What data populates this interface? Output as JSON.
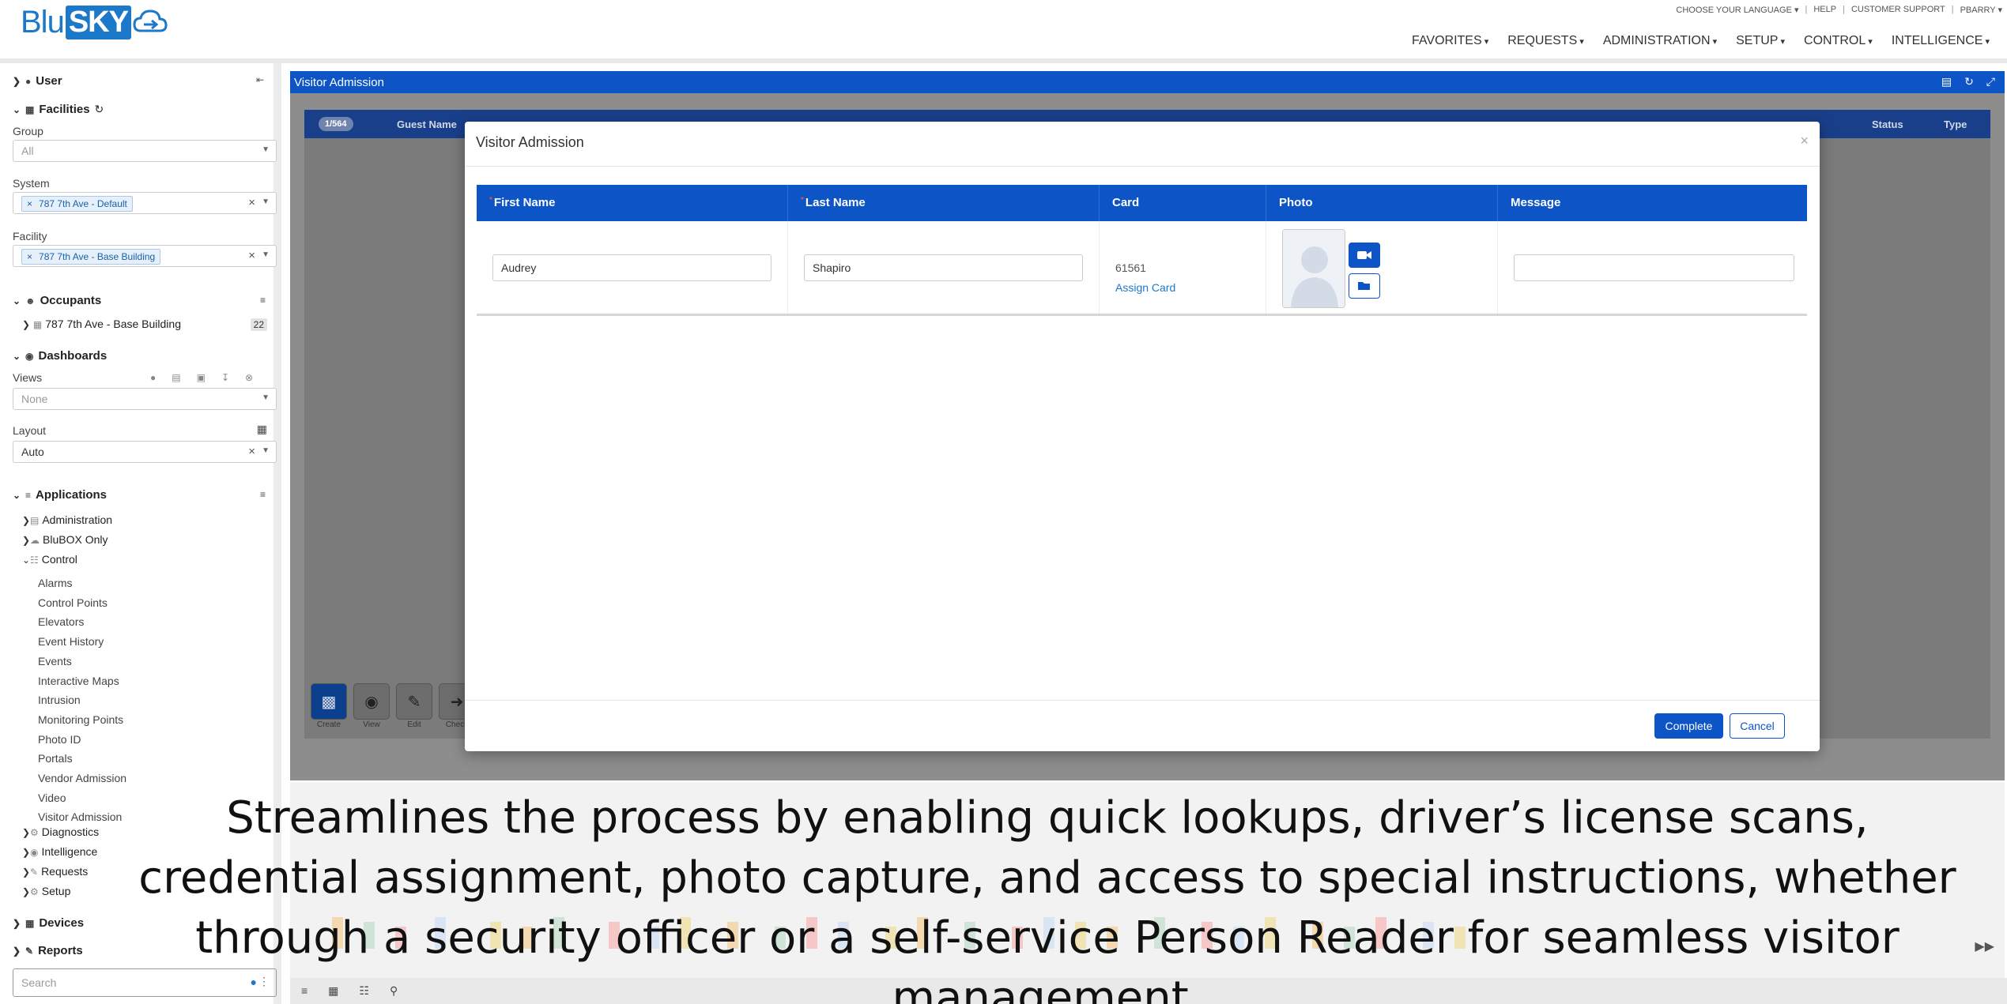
{
  "header": {
    "logo_blu": "Blu",
    "logo_sky": "SKY",
    "util_links": [
      "CHOOSE YOUR LANGUAGE ▾",
      "HELP",
      "CUSTOMER SUPPORT",
      "PBARRY ▾"
    ],
    "nav": [
      "FAVORITES",
      "REQUESTS",
      "ADMINISTRATION",
      "SETUP",
      "CONTROL",
      "INTELLIGENCE"
    ]
  },
  "sidebar": {
    "user_label": "User",
    "facilities_label": "Facilities",
    "group_label": "Group",
    "group_value": "All",
    "system_label": "System",
    "system_tag": "787 7th Ave - Default",
    "facility_label": "Facility",
    "facility_tag": "787 7th Ave - Base Building",
    "occupants_label": "Occupants",
    "occupant_item": "787 7th Ave - Base Building",
    "occupant_count": "22",
    "dashboards_label": "Dashboards",
    "views_label": "Views",
    "views_value": "None",
    "layout_label": "Layout",
    "layout_value": "Auto",
    "applications_label": "Applications",
    "app_items": [
      "Administration",
      "BluBOX Only",
      "Control"
    ],
    "control_children": [
      "Alarms",
      "Control Points",
      "Elevators",
      "Event History",
      "Events",
      "Interactive Maps",
      "Intrusion",
      "Monitoring Points",
      "Photo ID",
      "Portals",
      "Vendor Admission",
      "Video",
      "Visitor Admission"
    ],
    "app_items_after": [
      "Diagnostics",
      "Intelligence",
      "Requests",
      "Setup"
    ],
    "devices_label": "Devices",
    "reports_label": "Reports",
    "search_placeholder": "Search"
  },
  "panel": {
    "title": "Visitor Admission",
    "record_pill": "1/564",
    "grid_headers": [
      "Guest Name",
      "Status",
      "Type"
    ],
    "actions": [
      "Create",
      "View",
      "Edit",
      "Check"
    ]
  },
  "modal": {
    "title": "Visitor Admission",
    "close": "×",
    "columns": [
      "First Name",
      "Last Name",
      "Card",
      "Photo",
      "Message"
    ],
    "first_name": "Audrey",
    "last_name": "Shapiro",
    "card_number": "61561",
    "assign_card": "Assign Card",
    "message": "",
    "complete": "Complete",
    "cancel": "Cancel"
  },
  "caption": "Streamlines the process by enabling quick lookups, driver’s license scans, credential assignment, photo capture, and access to special instructions, whether through a security officer or a self-service Person Reader for seamless visitor management.",
  "colors": {
    "brand_blue": "#0d55c6",
    "link_blue": "#1c78c9",
    "overlay_grey": "#8d8d8d"
  }
}
